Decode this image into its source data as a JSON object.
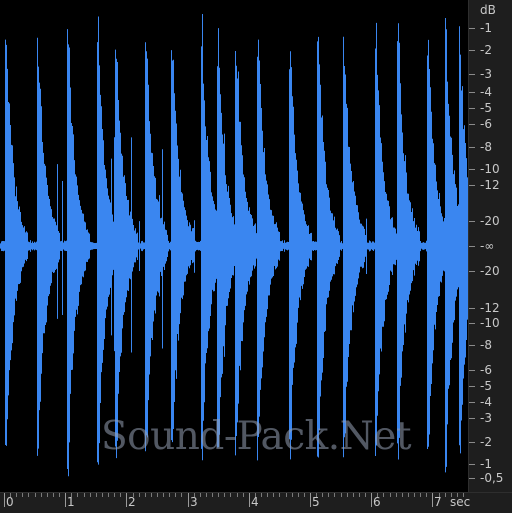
{
  "colors": {
    "waveform": "#3a86f0",
    "background": "#000000",
    "ruler_bg": "#1e1e1e",
    "ruler_text": "#c8c8c8"
  },
  "watermark": "Sound-Pack.Net",
  "db_ruler": {
    "unit": "dB",
    "labels": [
      "-1",
      "-2",
      "-3",
      "-4",
      "-5",
      "-6",
      "-8",
      "-10",
      "-12",
      "-20",
      "-∞",
      "-20",
      "-12",
      "-10",
      "-8",
      "-6",
      "-5",
      "-4",
      "-3",
      "-2",
      "-1",
      "-0,5"
    ]
  },
  "time_ruler": {
    "unit": "sec",
    "labels": [
      "0",
      "1",
      "2",
      "3",
      "4",
      "5",
      "6",
      "7"
    ]
  }
}
